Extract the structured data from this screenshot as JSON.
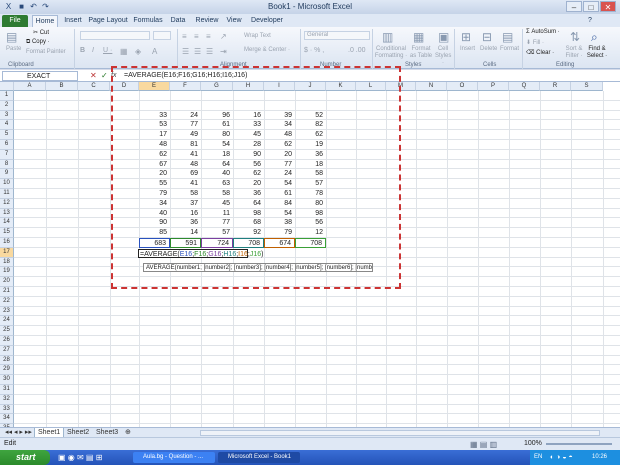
{
  "window": {
    "title": "Book1 - Microsoft Excel",
    "min": "–",
    "max": "□",
    "close": "✕"
  },
  "tabs": [
    "File",
    "Home",
    "Insert",
    "Page Layout",
    "Formulas",
    "Data",
    "Review",
    "View",
    "Developer"
  ],
  "ribbon": {
    "paste": "Paste",
    "cut": "Cut",
    "copy": "Copy ·",
    "format_painter": "Format Painter",
    "clipboard_group": "Clipboard",
    "bold": "B",
    "italic": "I",
    "underline": "U ·",
    "wrap_text": "Wrap Text",
    "merge_center": "Merge & Center ·",
    "alignment_group": "Alignment",
    "number_format": "General",
    "number_group": "Number",
    "conditional_formatting": "Conditional Formatting ·",
    "format_as_table": "Format as Table ·",
    "cell_styles": "Cell Styles ·",
    "styles_group": "Styles",
    "insert": "Insert",
    "delete": "Delete",
    "format": "Format",
    "cells_group": "Cells",
    "autosum": "AutoSum ·",
    "fill": "Fill ·",
    "clear": "Clear ·",
    "sort_filter": "Sort & Filter ·",
    "find_select": "Find & Select ·",
    "editing_group": "Editing"
  },
  "formula_bar": {
    "name_box": "EXACT",
    "cancel": "✕",
    "enter": "✓",
    "fx": "fx",
    "formula": "=AVERAGE(E16;F16;G16;H16;I16;J16)"
  },
  "columns": [
    "A",
    "B",
    "C",
    "D",
    "E",
    "F",
    "G",
    "H",
    "I",
    "J",
    "K",
    "L",
    "M",
    "N",
    "O",
    "P",
    "Q",
    "R",
    "S"
  ],
  "rows": [
    "1",
    "2",
    "3",
    "4",
    "5",
    "6",
    "7",
    "8",
    "9",
    "10",
    "11",
    "12",
    "13",
    "14",
    "15",
    "16",
    "17",
    "18",
    "19",
    "20",
    "21",
    "22",
    "23",
    "24",
    "25",
    "26",
    "27",
    "28",
    "29",
    "30",
    "31",
    "32",
    "33",
    "34",
    "35"
  ],
  "data_rows": [
    [
      33,
      24,
      96,
      16,
      39,
      52
    ],
    [
      53,
      77,
      61,
      33,
      34,
      82
    ],
    [
      17,
      49,
      80,
      45,
      48,
      62
    ],
    [
      48,
      81,
      54,
      28,
      62,
      19
    ],
    [
      62,
      41,
      18,
      90,
      20,
      36
    ],
    [
      67,
      48,
      64,
      56,
      77,
      18
    ],
    [
      20,
      69,
      40,
      62,
      24,
      58
    ],
    [
      55,
      41,
      63,
      20,
      54,
      57
    ],
    [
      79,
      58,
      58,
      36,
      61,
      78
    ],
    [
      34,
      37,
      45,
      64,
      84,
      80
    ],
    [
      40,
      16,
      11,
      98,
      54,
      98
    ],
    [
      90,
      36,
      77,
      68,
      38,
      56
    ],
    [
      85,
      14,
      57,
      92,
      79,
      12
    ]
  ],
  "totals": [
    683,
    591,
    724,
    708,
    674,
    708
  ],
  "edit_cell": {
    "prefix": "=AVERAGE(",
    "args": [
      "E16",
      "F16",
      "G16",
      "H16",
      "I16",
      "J16"
    ],
    "suffix": ")"
  },
  "tooltip": "AVERAGE(number1; [number2]; [number3]; [number4]; [number5]; [number6]; [number7]; ...)",
  "sheets": [
    "Sheet1",
    "Sheet2",
    "Sheet3"
  ],
  "status": {
    "mode": "Edit",
    "zoom": "100%"
  },
  "taskbar": {
    "start": "start",
    "buttons": [
      "Aula.bg - Question - ...",
      "Microsoft Excel - Book1"
    ],
    "lang": "EN",
    "clock": "10:26"
  },
  "colors": {
    "ref_colors": [
      "#2a52be",
      "#2e8b2e",
      "#7b3fa0",
      "#1f7f7f",
      "#c06000",
      "#3aa037"
    ],
    "annotation": "#cc3333"
  }
}
